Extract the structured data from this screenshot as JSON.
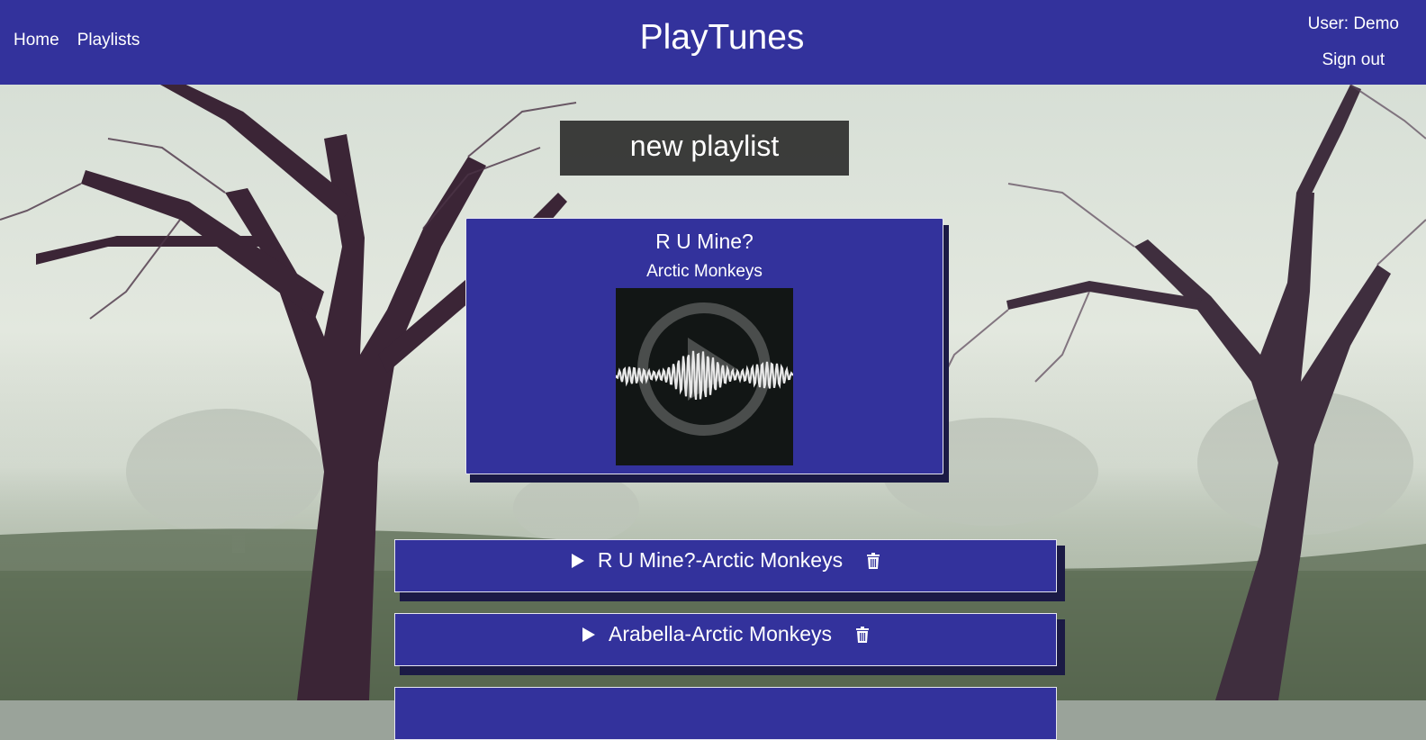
{
  "header": {
    "nav": [
      {
        "label": "Home"
      },
      {
        "label": "Playlists"
      }
    ],
    "brand": "PlayTunes",
    "user_label": "User: Demo",
    "signout_label": "Sign out"
  },
  "new_playlist_label": "new playlist",
  "now_playing": {
    "title": "R U Mine?",
    "artist": "Arctic Monkeys"
  },
  "playlist": [
    {
      "label": "R U Mine?-Arctic Monkeys",
      "play_icon": "play-icon",
      "delete_icon": "trash-icon"
    },
    {
      "label": "Arabella-Arctic Monkeys",
      "play_icon": "play-icon",
      "delete_icon": "trash-icon"
    }
  ],
  "colors": {
    "header_bg": "#33329c",
    "card_bg": "#33329c",
    "text": "#ffffff"
  }
}
